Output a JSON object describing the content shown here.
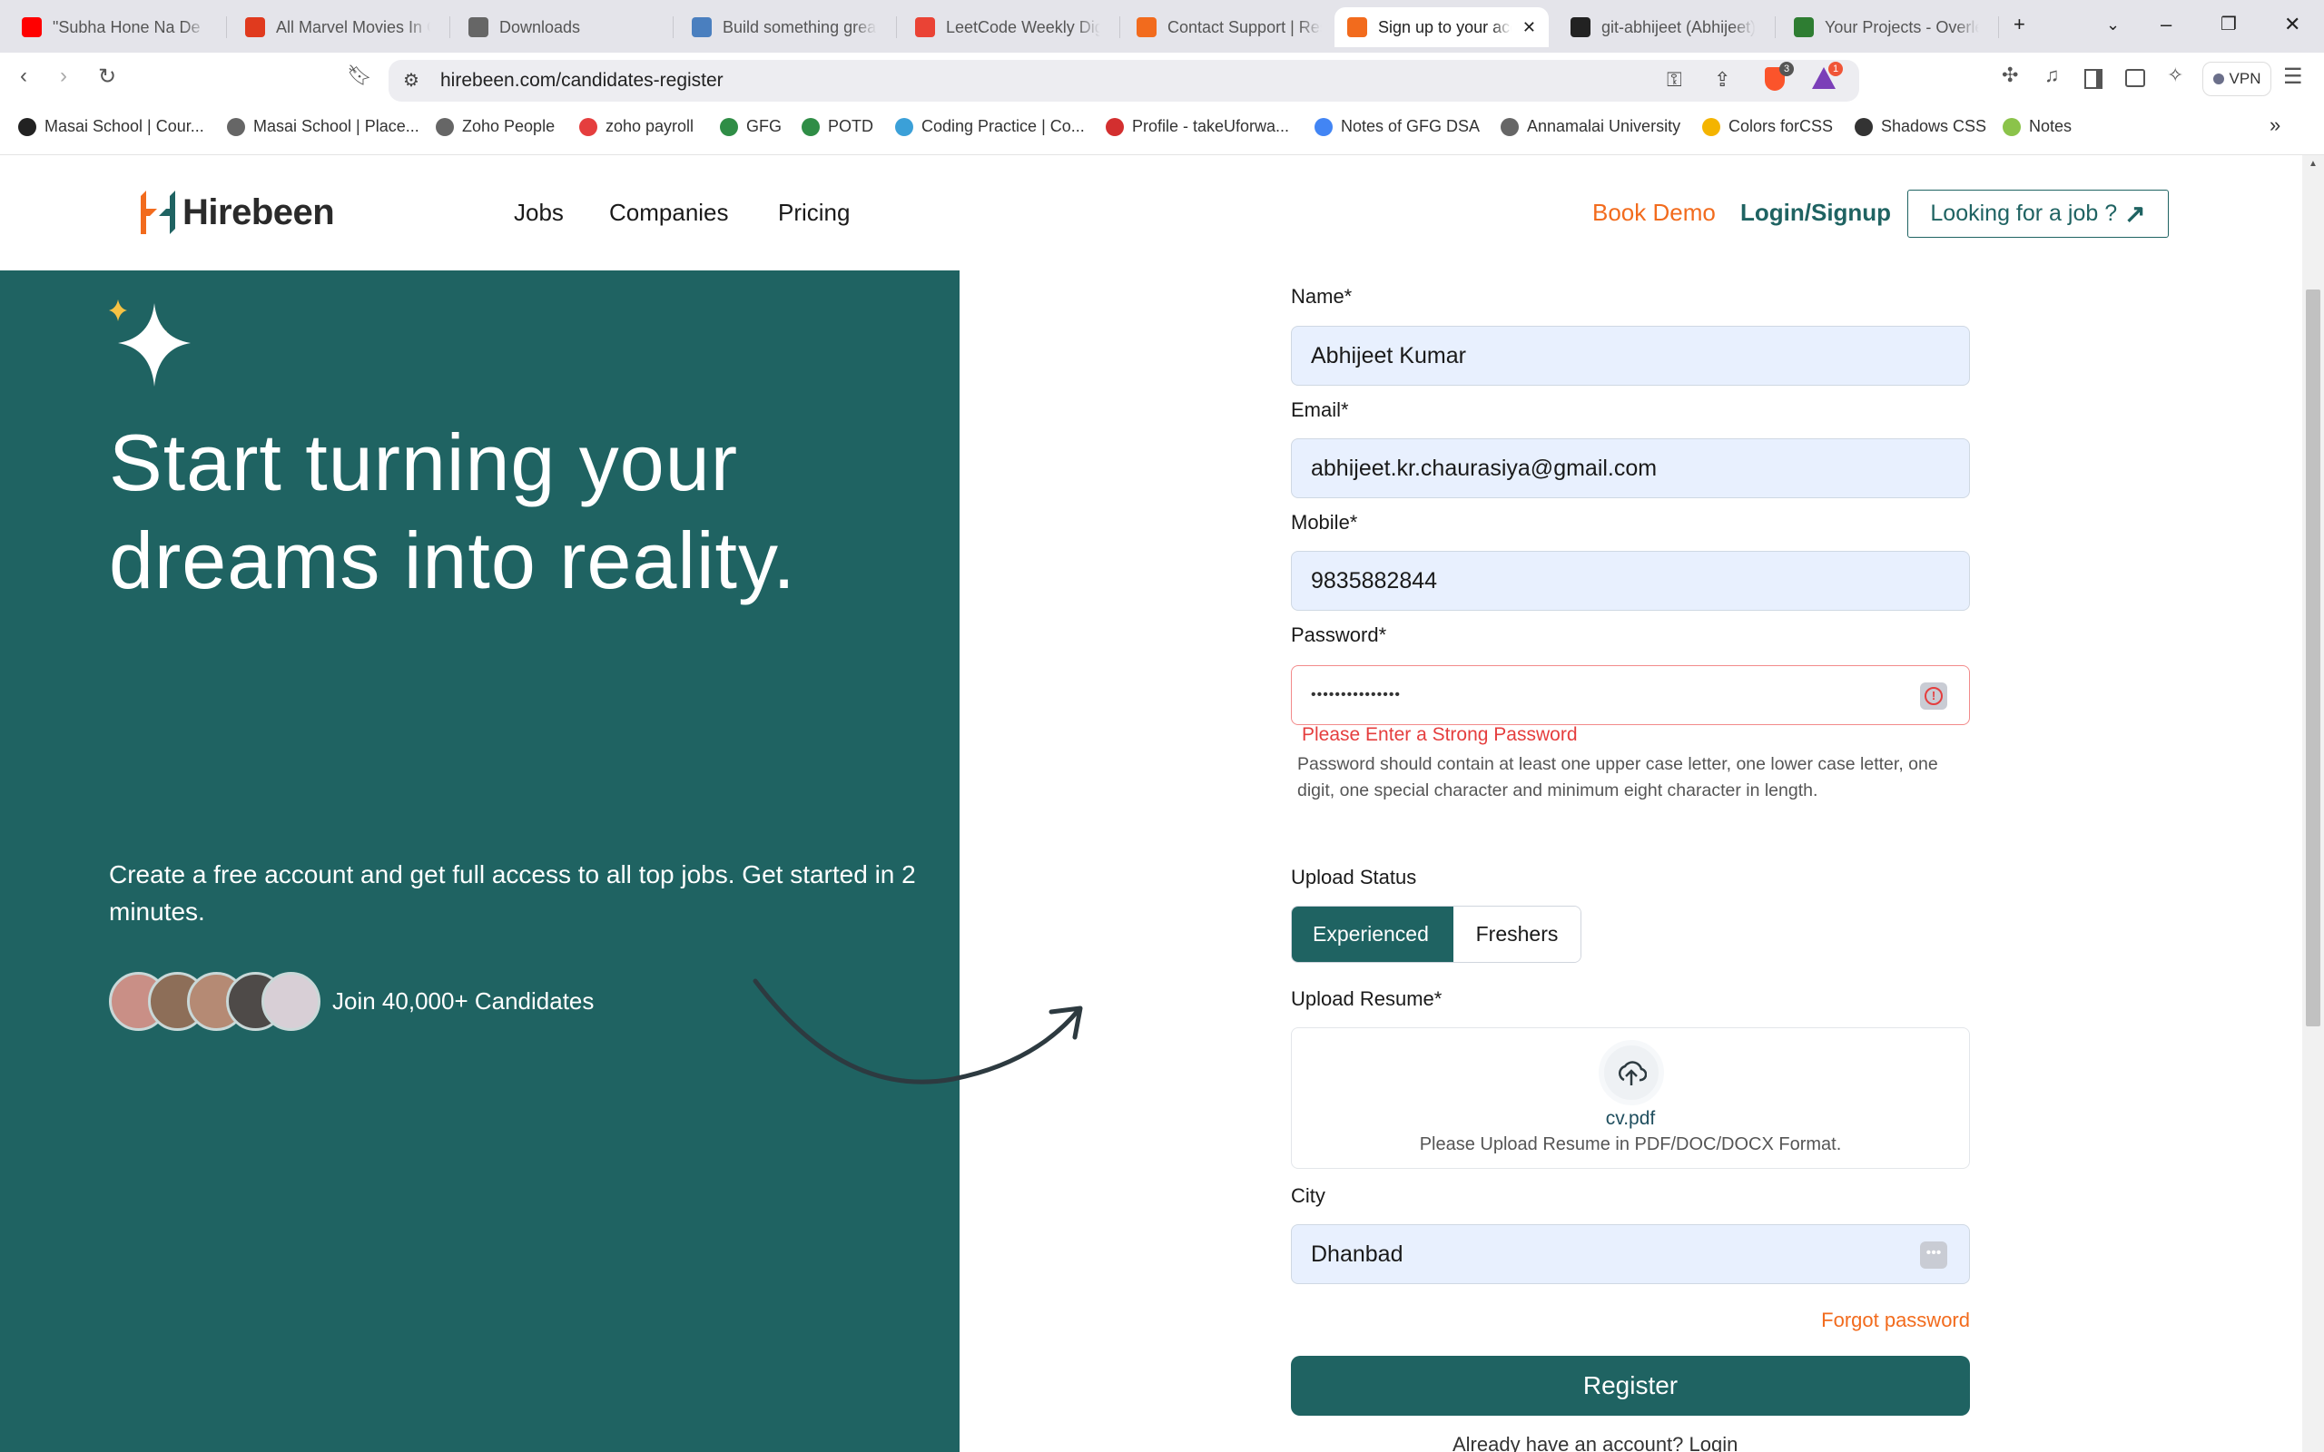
{
  "browser": {
    "tabs": [
      {
        "title": "\"Subha Hone Na De",
        "icon": "youtube-icon",
        "color": "#ff0000"
      },
      {
        "title": "All Marvel Movies In Order",
        "icon": "tomato-icon",
        "color": "#e03a1e"
      },
      {
        "title": "Downloads",
        "icon": "download-icon",
        "color": "#666666"
      },
      {
        "title": "Build something great",
        "icon": "avatar-icon",
        "color": "#4a7fbf"
      },
      {
        "title": "LeetCode Weekly Digest",
        "icon": "gmail-icon",
        "color": "#ea4335"
      },
      {
        "title": "Contact Support | Resources",
        "icon": "hirebeen-icon",
        "color": "#f26b1d"
      },
      {
        "title": "Sign up to your account",
        "icon": "hirebeen-icon",
        "color": "#f26b1d",
        "active": true
      },
      {
        "title": "git-abhijeet (Abhijeet)",
        "icon": "github-icon",
        "color": "#222222"
      },
      {
        "title": "Your Projects - Overleaf",
        "icon": "overleaf-icon",
        "color": "#2e7d32"
      }
    ],
    "url": "hirebeen.com/candidates-register",
    "vpn_label": "VPN",
    "brave_badge": "3",
    "rewards_badge": "1",
    "bookmarks": [
      {
        "label": "Masai School | Cour...",
        "color": "#222222"
      },
      {
        "label": "Masai School | Place...",
        "color": "#666666"
      },
      {
        "label": "Zoho People",
        "color": "#666666"
      },
      {
        "label": "zoho payroll",
        "color": "#e53e3e"
      },
      {
        "label": "GFG",
        "color": "#2f8d46"
      },
      {
        "label": "POTD",
        "color": "#2f8d46"
      },
      {
        "label": "Coding Practice | Co...",
        "color": "#3ba0d8"
      },
      {
        "label": "Profile - takeUforwa...",
        "color": "#d32f2f"
      },
      {
        "label": "Notes of GFG DSA",
        "color": "#4285f4"
      },
      {
        "label": "Annamalai University",
        "color": "#666666"
      },
      {
        "label": "Colors forCSS",
        "color": "#f4b400"
      },
      {
        "label": "Shadows CSS",
        "color": "#333333"
      },
      {
        "label": "Notes",
        "color": "#8bc34a"
      }
    ]
  },
  "header": {
    "brand": "Hirebeen",
    "nav": [
      "Jobs",
      "Companies",
      "Pricing"
    ],
    "book_demo": "Book Demo",
    "login": "Login/Signup",
    "job_button": "Looking for a job ?"
  },
  "hero": {
    "title": "Start turning your dreams into reality.",
    "subtitle": "Create a free account and get full access to all top jobs. Get started in 2 minutes.",
    "join": "Join 40,000+ Candidates"
  },
  "form": {
    "name_label": "Name*",
    "name_value": "Abhijeet Kumar",
    "email_label": "Email*",
    "email_value": "abhijeet.kr.chaurasiya@gmail.com",
    "mobile_label": "Mobile*",
    "mobile_value": "9835882844",
    "password_label": "Password*",
    "password_value": "•••••••••••••••",
    "password_error": "Please Enter a Strong Password",
    "password_hint": "Password should contain at least one upper case letter, one lower case letter, one digit, one special character and minimum eight character in length.",
    "status_label": "Upload Status",
    "status_options": [
      "Experienced",
      "Freshers"
    ],
    "resume_label": "Upload Resume*",
    "resume_file": "cv.pdf",
    "resume_hint": "Please Upload Resume in PDF/DOC/DOCX Format.",
    "city_label": "City",
    "city_value": "Dhanbad",
    "forgot": "Forgot password",
    "register": "Register",
    "already": "Already have an account? Login"
  },
  "colors": {
    "brand": "#1f6362",
    "accent": "#f26b1d",
    "error": "#e53e3e"
  }
}
